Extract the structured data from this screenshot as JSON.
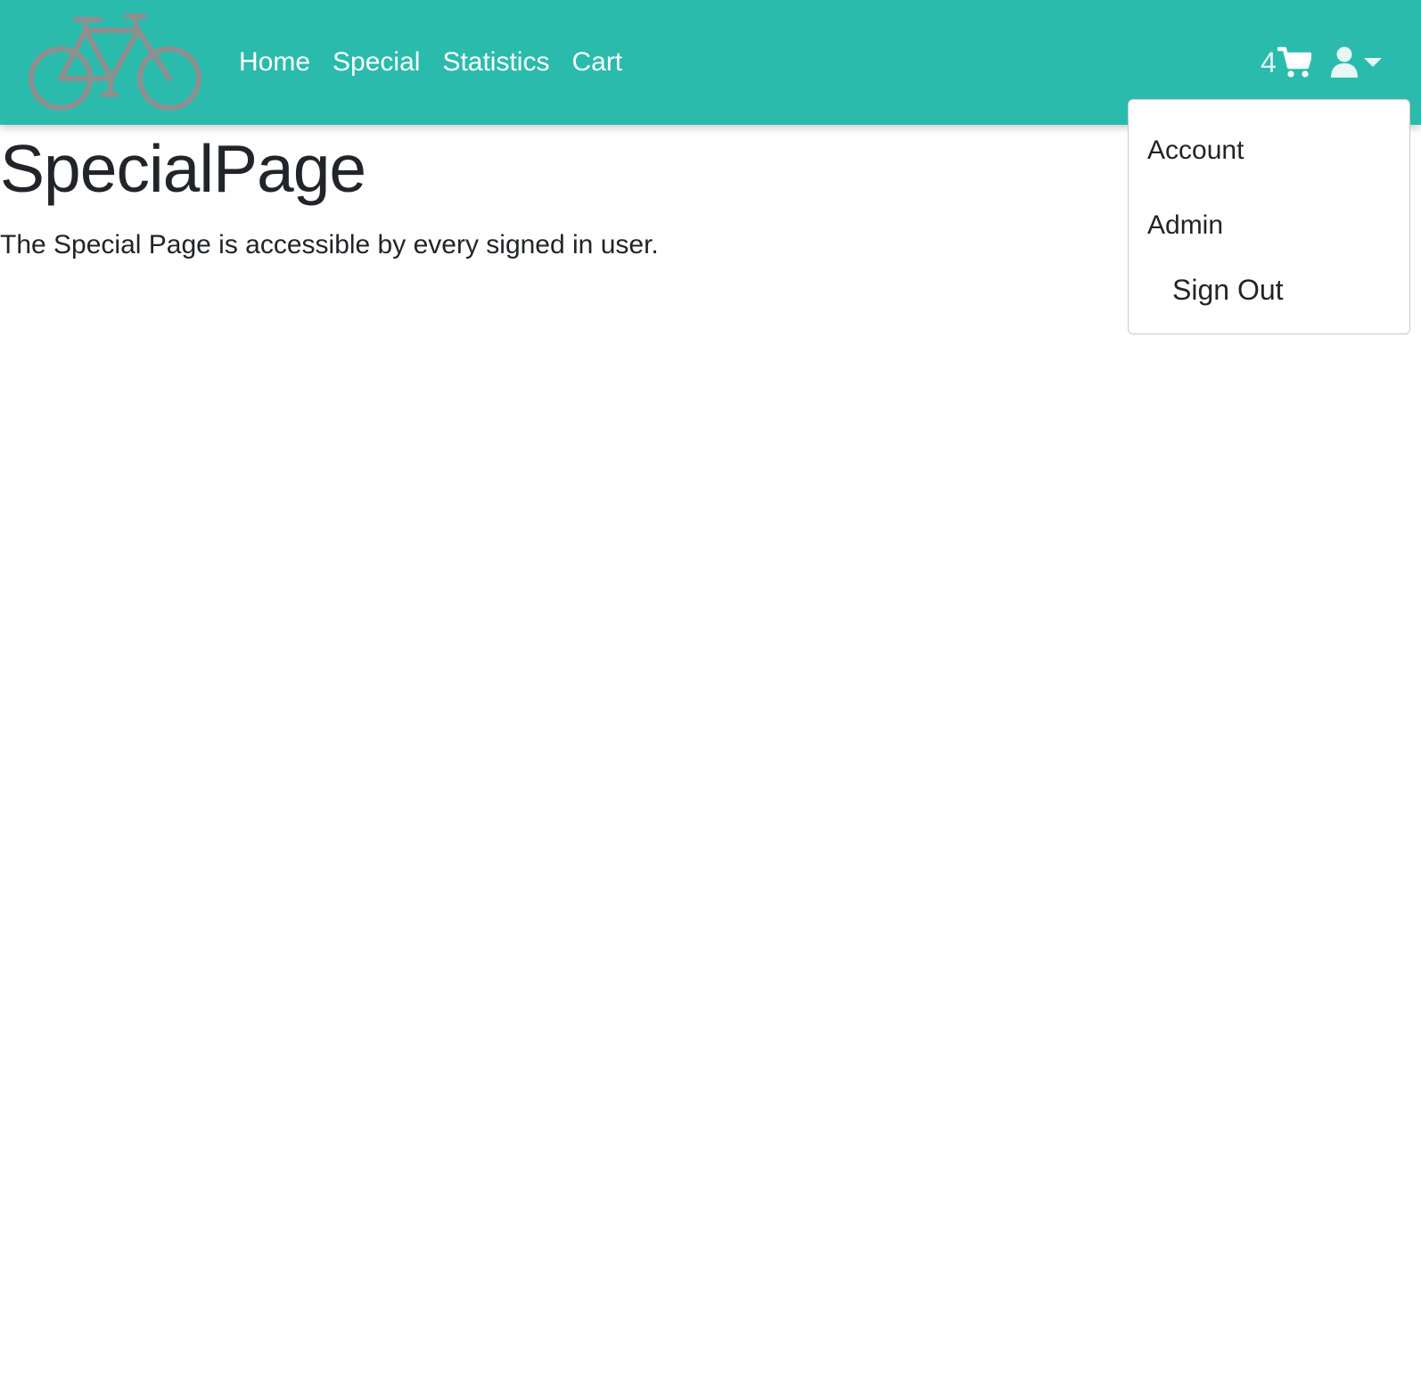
{
  "navbar": {
    "background_color": "#2bbbad",
    "brand_icon": "bicycle-icon",
    "links": [
      {
        "label": "Home"
      },
      {
        "label": "Special"
      },
      {
        "label": "Statistics"
      },
      {
        "label": "Cart"
      }
    ],
    "cart_count": "4",
    "cart_icon": "shopping-cart-icon",
    "user_icon": "user-icon",
    "dropdown_icon": "caret-down-icon"
  },
  "user_menu": {
    "items": [
      {
        "label": "Account"
      },
      {
        "label": "Admin"
      },
      {
        "label": "Sign Out"
      }
    ]
  },
  "main": {
    "title": "SpecialPage",
    "text": "The Special Page is accessible by every signed in user."
  }
}
